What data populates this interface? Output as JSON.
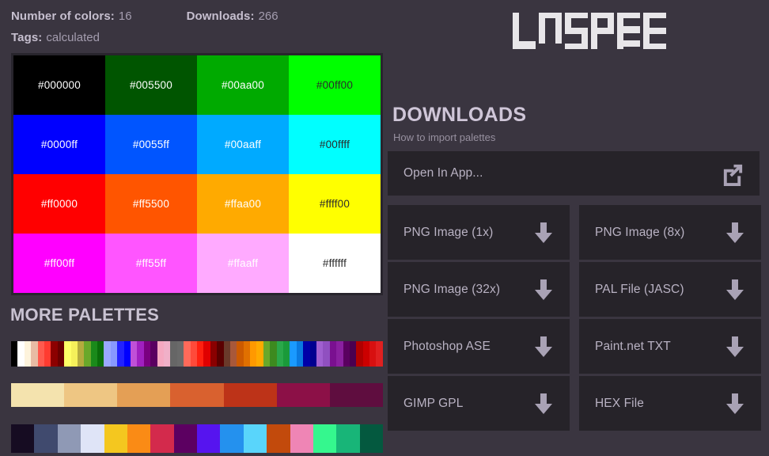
{
  "meta": {
    "colors_label": "Number of colors:",
    "colors_value": "16",
    "downloads_label": "Downloads:",
    "downloads_value": "266",
    "tags_label": "Tags:",
    "tags_value": "calculated"
  },
  "brand": {
    "name": "LOSPEC",
    "letters": [
      "L",
      "O",
      "S",
      "P",
      "E",
      "C"
    ],
    "color": "#e8e6e9"
  },
  "palette": {
    "swatches": [
      {
        "hex": "#000000",
        "label": "#000000",
        "text": "#ffffff"
      },
      {
        "hex": "#005500",
        "label": "#005500",
        "text": "#ffffff"
      },
      {
        "hex": "#00aa00",
        "label": "#00aa00",
        "text": "#ffffff"
      },
      {
        "hex": "#00ff00",
        "label": "#00ff00",
        "text": "#2b2b2b"
      },
      {
        "hex": "#0000ff",
        "label": "#0000ff",
        "text": "#ffffff"
      },
      {
        "hex": "#0055ff",
        "label": "#0055ff",
        "text": "#ffffff"
      },
      {
        "hex": "#00aaff",
        "label": "#00aaff",
        "text": "#ffffff"
      },
      {
        "hex": "#00ffff",
        "label": "#00ffff",
        "text": "#2b2b2b"
      },
      {
        "hex": "#ff0000",
        "label": "#ff0000",
        "text": "#ffffff"
      },
      {
        "hex": "#ff5500",
        "label": "#ff5500",
        "text": "#ffffff"
      },
      {
        "hex": "#ffaa00",
        "label": "#ffaa00",
        "text": "#ffffff"
      },
      {
        "hex": "#ffff00",
        "label": "#ffff00",
        "text": "#2b2b2b"
      },
      {
        "hex": "#ff00ff",
        "label": "#ff00ff",
        "text": "#ffffff"
      },
      {
        "hex": "#ff55ff",
        "label": "#ff55ff",
        "text": "#ffffff"
      },
      {
        "hex": "#ffaaff",
        "label": "#ffaaff",
        "text": "#ffffff"
      },
      {
        "hex": "#ffffff",
        "label": "#ffffff",
        "text": "#2b2b2b"
      }
    ]
  },
  "more_palettes": {
    "title": "MORE PALETTES",
    "strips": [
      {
        "colors": [
          "#000000",
          "#ffffff",
          "#fdf3dc",
          "#e8bba4",
          "#ff5a4e",
          "#ff3b30",
          "#8c0000",
          "#6b0000",
          "#ffff66",
          "#f5f05a",
          "#b5ab3e",
          "#6aa82a",
          "#1a8a1a",
          "#0a6e0a",
          "#9aa8ff",
          "#8899ff",
          "#2222ff",
          "#0000ff",
          "#c050d8",
          "#a020c0",
          "#7a0080",
          "#5a0060",
          "#f5a8c0",
          "#f0b0c8",
          "#666666",
          "#6a6a6a",
          "#ff6a5a",
          "#ff4a3a",
          "#ff2010",
          "#e00000",
          "#8a0000",
          "#5a0000",
          "#6a3a2a",
          "#a8583a",
          "#cc5a00",
          "#e07000",
          "#ff9900",
          "#ffaa00",
          "#6aa82a",
          "#3d8a1f",
          "#2aa84a",
          "#1a9a3a",
          "#1a9aff",
          "#0a7ae0",
          "#0000a8",
          "#000090",
          "#a060d0",
          "#9050c0",
          "#7a1090",
          "#8a20a0",
          "#5a0060",
          "#4a0050",
          "#b00000",
          "#cc0000",
          "#d81010",
          "#e02020"
        ]
      },
      {
        "colors": [
          "#f4e3ae",
          "#eec683",
          "#e49f55",
          "#d9612f",
          "#bd3318",
          "#8c1047",
          "#5f0d3f"
        ]
      },
      {
        "colors": [
          "#160c22",
          "#404a6e",
          "#8f99b5",
          "#dfe4f7",
          "#f4c71f",
          "#fa8b15",
          "#d32a4c",
          "#5c0061",
          "#5614ef",
          "#2491ee",
          "#59d5fb",
          "#c24a0c",
          "#ef85b5",
          "#35f78e",
          "#18b578",
          "#04593f"
        ]
      }
    ]
  },
  "downloads": {
    "title": "DOWNLOADS",
    "subtitle": "How to import palettes",
    "open_in_app": "Open In App...",
    "buttons": [
      {
        "label": "PNG Image (1x)"
      },
      {
        "label": "PNG Image (8x)"
      },
      {
        "label": "PNG Image (32x)"
      },
      {
        "label": "PAL File (JASC)"
      },
      {
        "label": "Photoshop ASE"
      },
      {
        "label": "Paint.net TXT"
      },
      {
        "label": "GIMP GPL"
      },
      {
        "label": "HEX File"
      }
    ]
  },
  "theme": {
    "background": "#3a3540",
    "button": "#262329",
    "text": "#b9b2c3",
    "heading": "#cfc6d8"
  }
}
